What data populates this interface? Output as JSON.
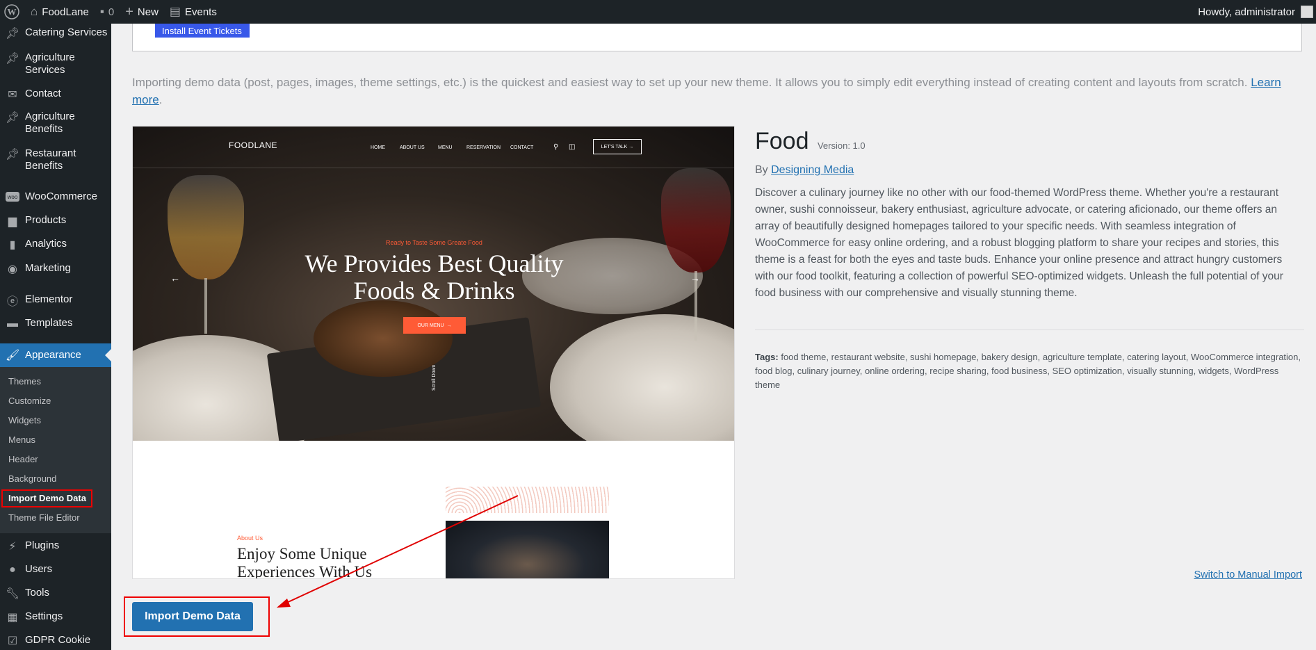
{
  "adminbar": {
    "site_name": "FoodLane",
    "comments_count": "0",
    "new_label": "New",
    "events_label": "Events",
    "howdy": "Howdy, administrator"
  },
  "sidebar": {
    "items": [
      {
        "label": "Catering Services",
        "icon": "pin-icon"
      },
      {
        "label": "Agriculture Services",
        "icon": "pin-icon"
      },
      {
        "label": "Contact",
        "icon": "mail-icon"
      },
      {
        "label": "Agriculture Benefits",
        "icon": "pin-icon"
      },
      {
        "label": "Restaurant Benefits",
        "icon": "pin-icon"
      },
      {
        "label": "WooCommerce",
        "icon": "woo-icon"
      },
      {
        "label": "Products",
        "icon": "archive-icon"
      },
      {
        "label": "Analytics",
        "icon": "chart-icon"
      },
      {
        "label": "Marketing",
        "icon": "megaphone-icon"
      },
      {
        "label": "Elementor",
        "icon": "elementor-icon"
      },
      {
        "label": "Templates",
        "icon": "folder-icon"
      },
      {
        "label": "Appearance",
        "icon": "brush-icon"
      },
      {
        "label": "Plugins",
        "icon": "plug-icon"
      },
      {
        "label": "Users",
        "icon": "user-icon"
      },
      {
        "label": "Tools",
        "icon": "wrench-icon"
      },
      {
        "label": "Settings",
        "icon": "settings-icon"
      },
      {
        "label": "GDPR Cookie",
        "icon": "check-icon"
      }
    ],
    "submenu": [
      "Themes",
      "Customize",
      "Widgets",
      "Menus",
      "Header",
      "Background",
      "Import Demo Data",
      "Theme File Editor"
    ]
  },
  "main": {
    "install_button": "Install Event Tickets",
    "intro_text": "Importing demo data (post, pages, images, theme settings, etc.) is the quickest and easiest way to set up your new theme. It allows you to simply edit everything instead of creating content and layouts from scratch.",
    "learn_more": "Learn more",
    "preview": {
      "logo": "FOODLANE",
      "nav": [
        "HOME",
        "ABOUT US",
        "MENU",
        "RESERVATION",
        "CONTACT"
      ],
      "lets_talk": "LET'S TALK",
      "hero_small": "Ready to Taste Some Greate Food",
      "hero_title_1": "We Provides Best Quality",
      "hero_title_2": "Foods & Drinks",
      "hero_button": "OUR MENU",
      "scroll": "Scroll Down",
      "about_small": "About Us",
      "about_title": "Enjoy Some Unique Experiences With Us"
    },
    "theme": {
      "name": "Food",
      "version": "Version: 1.0",
      "by": "By",
      "author": "Designing Media",
      "description": "Discover a culinary journey like no other with our food-themed WordPress theme. Whether you're a restaurant owner, sushi connoisseur, bakery enthusiast, agriculture advocate, or catering aficionado, our theme offers an array of beautifully designed homepages tailored to your specific needs. With seamless integration of WooCommerce for easy online ordering, and a robust blogging platform to share your recipes and stories, this theme is a feast for both the eyes and taste buds. Enhance your online presence and attract hungry customers with our food toolkit, featuring a collection of powerful SEO-optimized widgets. Unleash the full potential of your food business with our comprehensive and visually stunning theme.",
      "tags_label": "Tags:",
      "tags": "food theme, restaurant website, sushi homepage, bakery design, agriculture template, catering layout, WooCommerce integration, food blog, culinary journey, online ordering, recipe sharing, food business, SEO optimization, visually stunning, widgets, WordPress theme"
    },
    "switch_link": "Switch to Manual Import",
    "import_button": "Import Demo Data"
  },
  "colors": {
    "admin_dark": "#1d2327",
    "accent_blue": "#2271b1",
    "annotation_red": "#e00000",
    "preview_orange": "#ff5b36"
  }
}
